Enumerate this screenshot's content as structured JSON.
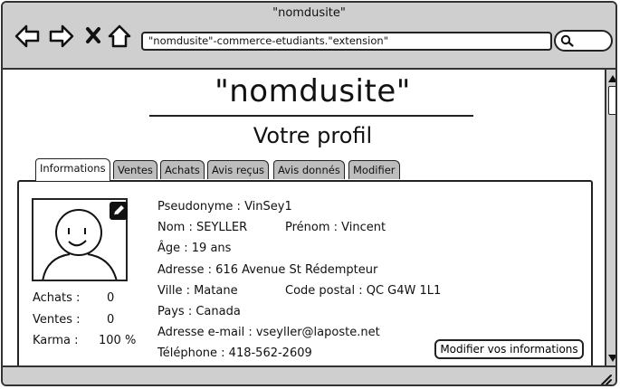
{
  "window": {
    "title": "\"nomdusite\""
  },
  "toolbar": {
    "back_icon": "back-arrow-icon",
    "forward_icon": "forward-arrow-icon",
    "stop_icon": "close-icon",
    "home_icon": "home-icon",
    "address": "\"nomdusite\"-commerce-etudiants.\"extension\"",
    "search_icon": "search-icon"
  },
  "page": {
    "site_title": "\"nomdusite\"",
    "subtitle": "Votre profil"
  },
  "tabs": [
    {
      "label": "Informations",
      "active": true
    },
    {
      "label": "Ventes"
    },
    {
      "label": "Achats"
    },
    {
      "label": "Avis reçus"
    },
    {
      "label": "Avis donnés"
    },
    {
      "label": "Modifier"
    }
  ],
  "stats": {
    "purchases_label": "Achats :",
    "purchases_value": "0",
    "sales_label": "Ventes :",
    "sales_value": "0",
    "karma_label": "Karma :",
    "karma_value": "100 %"
  },
  "profile": {
    "pseudo": "Pseudonyme :  VinSey1",
    "lastname": "Nom : SEYLLER",
    "firstname": "Prénom :  Vincent",
    "age": "Âge :  19 ans",
    "address": "Adresse :  616 Avenue St Rédempteur",
    "city": "Ville : Matane",
    "postal": "Code postal :  QC G4W 1L1",
    "country": "Pays :  Canada",
    "email": "Adresse e-mail :  vseyller@laposte.net",
    "phone": "Téléphone : 418-562-2609"
  },
  "actions": {
    "modify_label": "Modifier vos informations",
    "edit_icon": "pencil-icon"
  },
  "avatar_icon": "smiley-face-icon"
}
